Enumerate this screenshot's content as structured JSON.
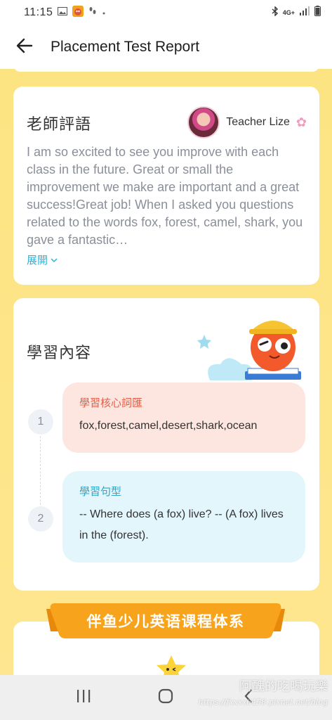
{
  "status_bar": {
    "time": "11:15",
    "network": "4G+"
  },
  "header": {
    "title": "Placement Test Report"
  },
  "teacher_comment": {
    "title": "老師評語",
    "teacher_name": "Teacher Lize",
    "text": "I am so excited to see you improve with each class in the future. Great or small the improvement we make are important and a great success!Great job! When I asked you questions related to the words fox, forest, camel, shark, you gave a fantastic…",
    "expand_label": "展開"
  },
  "learning": {
    "title": "學習內容",
    "items": [
      {
        "number": "1",
        "label": "學習核心詞匯",
        "content": "fox,forest,camel,desert,shark,ocean"
      },
      {
        "number": "2",
        "label": "學習句型",
        "content": "-- Where does (a fox) live? -- (A fox) lives in the (forest)."
      }
    ]
  },
  "course_banner": {
    "title": "伴鱼少儿英语课程体系"
  },
  "watermark": {
    "line1": "阿醜的吃喝玩樂",
    "line2": "https://fxxxx6458.pixnet.net/blog"
  },
  "colors": {
    "page_bg": "#fde692",
    "accent_blue": "#2eb3d6",
    "vocab_bg": "#fde5e0",
    "sentence_bg": "#e3f6fc",
    "banner_orange": "#f7a41c"
  }
}
